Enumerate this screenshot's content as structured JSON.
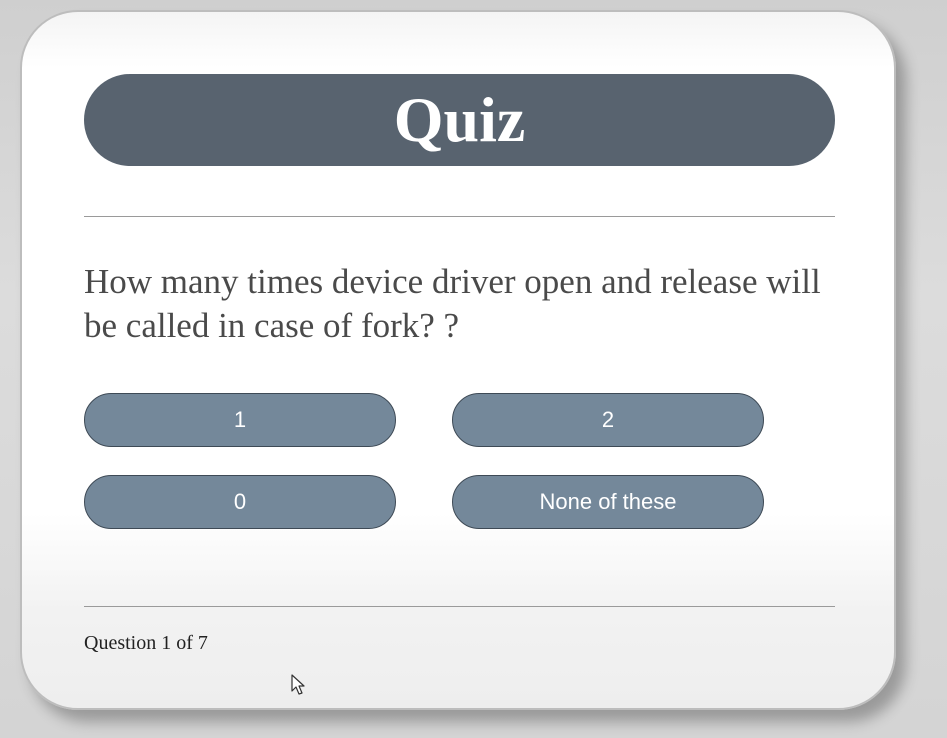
{
  "quiz": {
    "title": "Quiz",
    "question": "How many times device driver open and release will be called in case of fork? ?",
    "answers": [
      "1",
      "2",
      "0",
      "None of these"
    ],
    "progress_text": "Question 1 of 7"
  },
  "colors": {
    "title_bar": "#58636f",
    "answer_button": "#74889a",
    "answer_border": "#3e4a56",
    "question_text": "#4a4a4a"
  },
  "icons": {
    "cursor": "mouse-pointer-icon"
  }
}
